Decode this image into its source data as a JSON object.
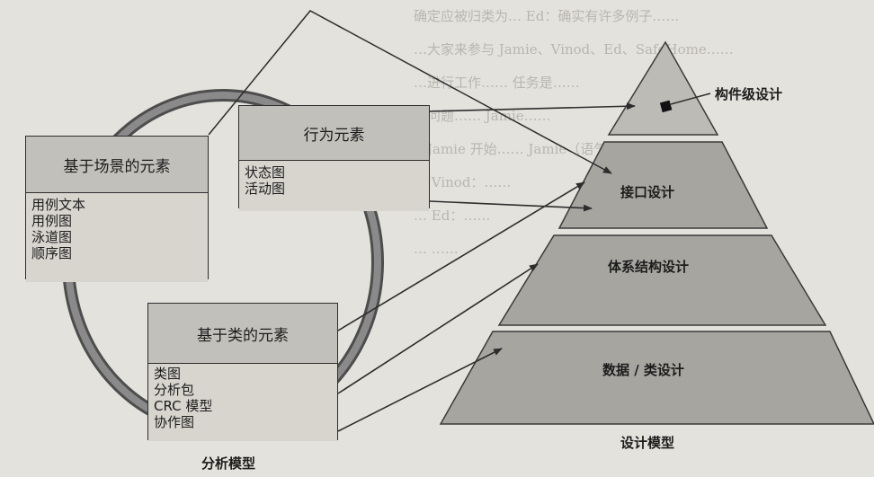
{
  "background_text": [
    "确定应被归类为…      Ed：确实有许多例子……",
    "…大家来参与 Jamie、Vinod、Ed、SafeHome……",
    "…进行工作……              任务是……",
    "…问题……                  Jamie……",
    "…Jamie 开始……            Jamie（语气）……",
    "…                         Vinod：……",
    "…                         Ed：……",
    "…                         ……"
  ],
  "analysis_model": {
    "label": "分析模型",
    "scenario_box": {
      "title": "基于场景的元素",
      "items": [
        "用例文本",
        "用例图",
        "泳道图",
        "顺序图"
      ]
    },
    "behavior_box": {
      "title": "行为元素",
      "items": [
        "状态图",
        "活动图"
      ]
    },
    "class_box": {
      "title": "基于类的元素",
      "items": [
        "类图",
        "分析包",
        "CRC 模型",
        "协作图"
      ]
    }
  },
  "design_model": {
    "label": "设计模型",
    "layers": [
      {
        "label": "构件级设计"
      },
      {
        "label": "接口设计"
      },
      {
        "label": "体系结构设计"
      },
      {
        "label": "数据 / 类设计"
      }
    ]
  },
  "colors": {
    "ring": "#6e6e6e",
    "box_head": "#c2c0bb",
    "box_body": "#d8d5cf",
    "pyramid_top": "#bdbbb6",
    "pyramid_layers": "#a7a5a0",
    "line": "#2d2d2d"
  }
}
